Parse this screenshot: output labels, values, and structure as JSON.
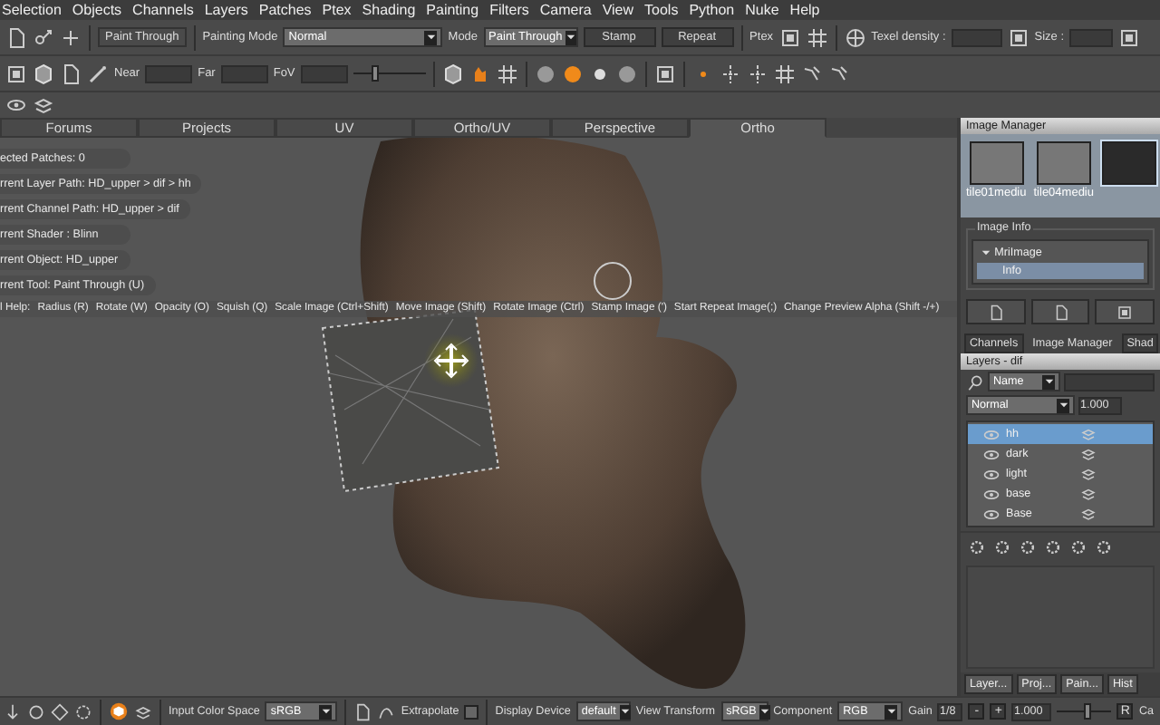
{
  "menu": [
    "Selection",
    "Objects",
    "Channels",
    "Layers",
    "Patches",
    "Ptex",
    "Shading",
    "Painting",
    "Filters",
    "Camera",
    "View",
    "Tools",
    "Python",
    "Nuke",
    "Help"
  ],
  "toolbar": {
    "tool_label": "Paint Through",
    "painting_mode": {
      "label": "Painting Mode",
      "value": "Normal"
    },
    "mode": {
      "label": "Mode",
      "value": "Paint Through"
    },
    "buttons": [
      "Stamp",
      "Repeat"
    ],
    "ptex_label": "Ptex",
    "texel_density_label": "Texel density :",
    "size_label": "Size :"
  },
  "camera_bar": {
    "near_label": "Near",
    "far_label": "Far",
    "fov_label": "FoV",
    "fov_slider": {
      "level": 0.3
    }
  },
  "view_tabs": [
    {
      "label": "Forums",
      "selected": false
    },
    {
      "label": "Projects",
      "selected": false
    },
    {
      "label": "UV",
      "selected": false
    },
    {
      "label": "Ortho/UV",
      "selected": false
    },
    {
      "label": "Perspective",
      "selected": false
    },
    {
      "label": "Ortho",
      "selected": true
    }
  ],
  "viewport": {
    "info_lines": [
      "ected Patches: 0",
      "rrent Layer Path: HD_upper > dif > hh",
      "rrent Channel Path: HD_upper > dif",
      "rrent Shader : Blinn",
      "rrent Object: HD_upper",
      "rrent Tool: Paint Through (U)"
    ],
    "help_items": [
      "l Help:",
      "Radius (R)",
      "Rotate (W)",
      "Opacity (O)",
      "Squish (Q)",
      "Scale Image (Ctrl+Shift)",
      "Move Image (Shift)",
      "Rotate Image (Ctrl)",
      "Stamp Image (')",
      "Start Repeat Image(;)",
      "Change Preview Alpha (Shift -/+)"
    ]
  },
  "image_manager": {
    "title": "Image Manager",
    "thumbnails": [
      {
        "label": "tile01mediu",
        "selected": false
      },
      {
        "label": "tile04mediu",
        "selected": false
      },
      {
        "selected": true
      }
    ],
    "image_info_title": "Image Info",
    "tree": [
      {
        "label": "MriImage",
        "expanded": true,
        "children": [
          {
            "label": "Info",
            "selected": true
          }
        ]
      }
    ]
  },
  "panel_tabs": [
    {
      "label": "Channels",
      "selected": false
    },
    {
      "label": "Image Manager",
      "selected": true
    },
    {
      "label": "Shad",
      "selected": false
    }
  ],
  "layers": {
    "title": "Layers - dif",
    "search_field": "Name",
    "blend_mode": "Normal",
    "opacity": "1.000",
    "items": [
      {
        "name": "hh",
        "selected": true
      },
      {
        "name": "dark",
        "selected": false
      },
      {
        "name": "light",
        "selected": false
      },
      {
        "name": "base",
        "selected": false
      },
      {
        "name": "Base",
        "selected": false
      }
    ]
  },
  "bottom_tabs": [
    "Layer...",
    "Proj...",
    "Pain...",
    "Hist"
  ],
  "status_bar": {
    "input_color_space": {
      "label": "Input Color Space",
      "value": "sRGB"
    },
    "extrapolate": {
      "label": "Extrapolate",
      "checked": false
    },
    "display_device": {
      "label": "Display Device",
      "value": "default"
    },
    "view_transform": {
      "label": "View Transform",
      "value": "sRGB"
    },
    "component": {
      "label": "Component",
      "value": "RGB"
    },
    "gain": {
      "label": "Gain",
      "value": "1/8",
      "minus": "-",
      "plus": "+",
      "amount": "1.000",
      "level": 0.55
    },
    "r_button": "R",
    "cut_label": "Ca"
  }
}
